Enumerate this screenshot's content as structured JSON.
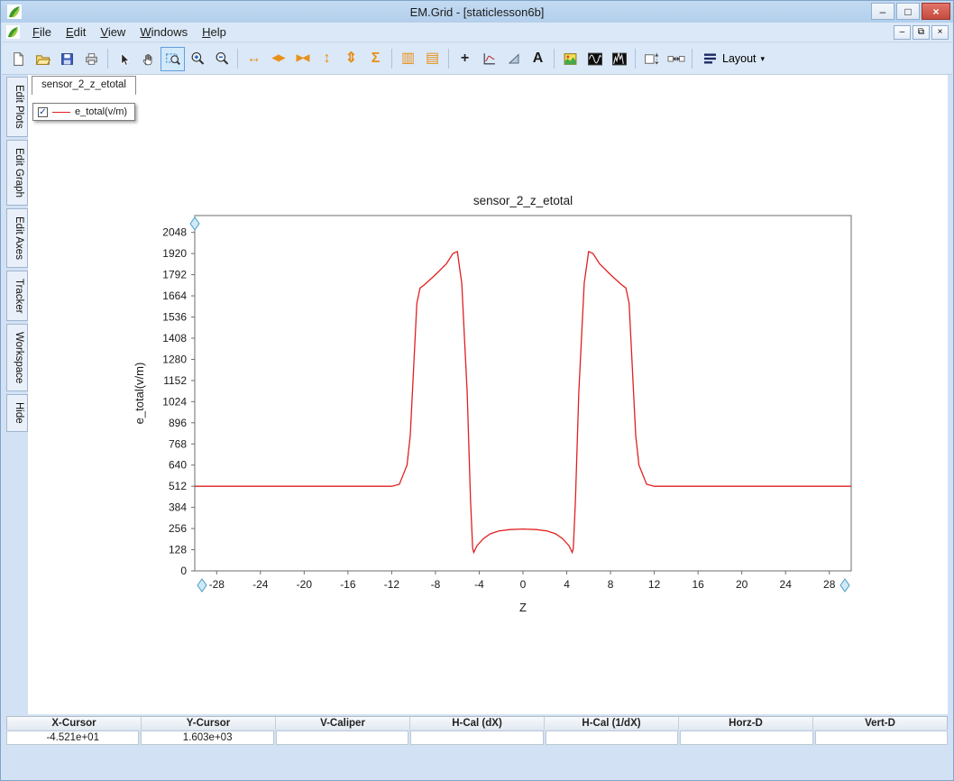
{
  "window": {
    "title": "EM.Grid - [staticlesson6b]"
  },
  "titlebar": {
    "buttons": [
      {
        "name": "minimize",
        "glyph": "–"
      },
      {
        "name": "maximize",
        "glyph": "□"
      },
      {
        "name": "close",
        "glyph": "×"
      }
    ]
  },
  "menu": {
    "items": [
      {
        "label": "File"
      },
      {
        "label": "Edit"
      },
      {
        "label": "View"
      },
      {
        "label": "Windows"
      },
      {
        "label": "Help"
      }
    ],
    "mdi_buttons": [
      {
        "name": "mdi-minimize",
        "glyph": "–"
      },
      {
        "name": "mdi-restore",
        "glyph": "⧉"
      },
      {
        "name": "mdi-close",
        "glyph": "×"
      }
    ]
  },
  "toolbar": {
    "items": [
      {
        "name": "new-document"
      },
      {
        "name": "open-file"
      },
      {
        "name": "save-file"
      },
      {
        "name": "print"
      },
      {
        "sep": true
      },
      {
        "name": "select-cursor"
      },
      {
        "name": "pan-hand"
      },
      {
        "name": "zoom-rect",
        "active": true
      },
      {
        "name": "zoom-in"
      },
      {
        "name": "zoom-out"
      },
      {
        "sep": true
      },
      {
        "name": "expand-x",
        "glyph": "↔",
        "color": "#e89018",
        "bold": true
      },
      {
        "name": "scroll-x",
        "glyph": "◀▶",
        "color": "#e89018",
        "small": true
      },
      {
        "name": "fit-x",
        "glyph": "▶◀",
        "color": "#e89018",
        "small": true
      },
      {
        "name": "expand-y",
        "glyph": "↕",
        "color": "#e89018",
        "bold": true
      },
      {
        "name": "fit-y",
        "glyph": "⇕",
        "color": "#e89018",
        "bold": true
      },
      {
        "name": "autoscale-sum",
        "glyph": "Σ",
        "color": "#e89018",
        "bold": true
      },
      {
        "sep": true
      },
      {
        "name": "vertical-panels",
        "glyph": "▥",
        "color": "#e89018"
      },
      {
        "name": "horizontal-panels",
        "glyph": "▤",
        "color": "#e89018"
      },
      {
        "sep": true
      },
      {
        "name": "add-marker",
        "glyph": "+",
        "color": "#282828",
        "bold": true
      },
      {
        "name": "axes-tracker"
      },
      {
        "name": "slope-triangle"
      },
      {
        "name": "text-annotation",
        "glyph": "A",
        "color": "#1a1a1a",
        "bold": true
      },
      {
        "sep": true
      },
      {
        "name": "image-export"
      },
      {
        "name": "fft-waveform"
      },
      {
        "name": "spectrum-waveform"
      },
      {
        "sep": true
      },
      {
        "name": "v-caliper-toggle"
      },
      {
        "name": "h-caliper-toggle"
      },
      {
        "sep": true
      },
      {
        "name": "layout-menu",
        "label": "Layout"
      }
    ]
  },
  "sidebar": {
    "tabs": [
      "Edit Plots",
      "Edit Graph",
      "Edit Axes",
      "Tracker",
      "Workspace",
      "Hide"
    ]
  },
  "document": {
    "tab_label": "sensor_2_z_etotal"
  },
  "legend": {
    "label": "e_total(v/m)",
    "checked": true,
    "check_glyph": "✓",
    "color": "#e02020"
  },
  "chart_data": {
    "type": "line",
    "title": "sensor_2_z_etotal",
    "xlabel": "Z",
    "ylabel": "e_total(v/m)",
    "xlim": [
      -30,
      30
    ],
    "ylim": [
      0,
      2150
    ],
    "x_ticks": [
      -28,
      -24,
      -20,
      -16,
      -12,
      -8,
      -4,
      0,
      4,
      8,
      12,
      16,
      20,
      24,
      28
    ],
    "y_ticks": [
      0,
      128,
      256,
      384,
      512,
      640,
      768,
      896,
      1024,
      1152,
      1280,
      1408,
      1536,
      1664,
      1792,
      1920,
      2048
    ],
    "grid": false,
    "legend_position": "top-left-floating",
    "series": [
      {
        "name": "e_total(v/m)",
        "color": "#e02020",
        "points": [
          [
            -30,
            512
          ],
          [
            -12,
            512
          ],
          [
            -11.3,
            524
          ],
          [
            -10.6,
            640
          ],
          [
            -10.3,
            820
          ],
          [
            -9.7,
            1620
          ],
          [
            -9.4,
            1712
          ],
          [
            -9,
            1732
          ],
          [
            -8,
            1792
          ],
          [
            -7,
            1858
          ],
          [
            -6.4,
            1920
          ],
          [
            -6,
            1932
          ],
          [
            -5.6,
            1740
          ],
          [
            -5.1,
            1080
          ],
          [
            -4.8,
            430
          ],
          [
            -4.6,
            136
          ],
          [
            -4.5,
            112
          ],
          [
            -4.2,
            152
          ],
          [
            -3.6,
            196
          ],
          [
            -3,
            224
          ],
          [
            -2.2,
            242
          ],
          [
            -1.2,
            250
          ],
          [
            0,
            253
          ],
          [
            1.2,
            250
          ],
          [
            2.2,
            242
          ],
          [
            3,
            224
          ],
          [
            3.6,
            196
          ],
          [
            4.2,
            152
          ],
          [
            4.5,
            112
          ],
          [
            4.6,
            136
          ],
          [
            4.8,
            430
          ],
          [
            5.1,
            1080
          ],
          [
            5.6,
            1740
          ],
          [
            6,
            1932
          ],
          [
            6.4,
            1920
          ],
          [
            7,
            1858
          ],
          [
            8,
            1792
          ],
          [
            9,
            1732
          ],
          [
            9.4,
            1712
          ],
          [
            9.7,
            1620
          ],
          [
            10.3,
            820
          ],
          [
            10.6,
            640
          ],
          [
            11.3,
            524
          ],
          [
            12,
            512
          ],
          [
            30,
            512
          ]
        ]
      }
    ]
  },
  "status_bar": {
    "columns": [
      {
        "key": "x-cursor",
        "header": "X-Cursor",
        "value": "-4.521e+01"
      },
      {
        "key": "y-cursor",
        "header": "Y-Cursor",
        "value": "1.603e+03"
      },
      {
        "key": "v-caliper",
        "header": "V-Caliper",
        "value": ""
      },
      {
        "key": "h-cal-dx",
        "header": "H-Cal (dX)",
        "value": ""
      },
      {
        "key": "h-cal-1dx",
        "header": "H-Cal (1/dX)",
        "value": ""
      },
      {
        "key": "horz-d",
        "header": "Horz-D",
        "value": ""
      },
      {
        "key": "vert-d",
        "header": "Vert-D",
        "value": ""
      }
    ]
  }
}
